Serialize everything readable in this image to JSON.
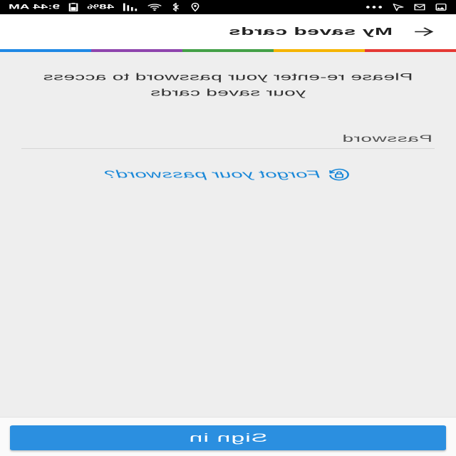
{
  "status_bar": {
    "notification_icons": [
      "image-icon",
      "mail-icon",
      "navigation-icon",
      "more-dots-icon"
    ],
    "system_icons": [
      "location-icon",
      "bluetooth-icon",
      "wifi-icon",
      "signal-icon",
      "battery-icon"
    ],
    "battery_percent": "48%",
    "time": "9:44 AM"
  },
  "header": {
    "back_icon": "back-arrow-icon",
    "title": "My saved cards"
  },
  "accent_stripe": [
    "#e53935",
    "#f5b400",
    "#43a047",
    "#8e44ad",
    "#1e88e5"
  ],
  "main": {
    "message": "Please re-enter your password to access your saved cards",
    "password_field": {
      "placeholder": "Password",
      "value": ""
    },
    "forgot_password": {
      "icon": "lock-reset-icon",
      "label": "Forgot your password?"
    }
  },
  "footer": {
    "sign_in_label": "Sign in"
  },
  "colors": {
    "background": "#eeeeee",
    "header": "#ffffff",
    "status_bar": "#000000",
    "link": "#1a88d8",
    "button": "#2b8fe0",
    "button_text": "#ffffff"
  }
}
